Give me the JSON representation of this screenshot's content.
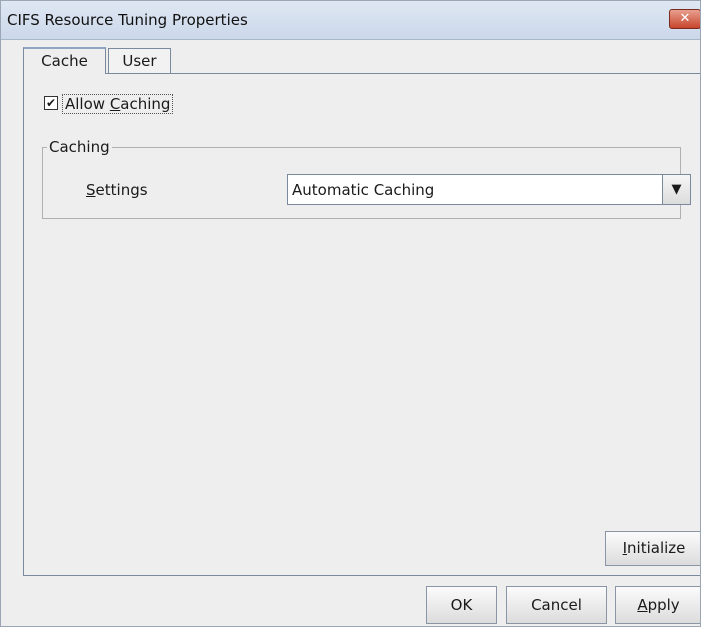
{
  "window": {
    "title": "CIFS Resource Tuning Properties",
    "close_glyph": "✕"
  },
  "tabs": [
    {
      "label": "Cache",
      "active": true
    },
    {
      "label": "User",
      "active": false
    }
  ],
  "cache": {
    "allow_caching": {
      "checked": true,
      "check_glyph": "✔",
      "label_prefix": "Allow ",
      "label_mnemonic": "C",
      "label_rest": "aching"
    },
    "group_title": "Caching",
    "settings": {
      "label_mnemonic": "S",
      "label_rest": "ettings",
      "value": "Automatic Caching",
      "arrow_glyph": "▼"
    },
    "initialize": {
      "mnemonic": "I",
      "rest": "nitialize"
    }
  },
  "buttons": {
    "ok": "OK",
    "cancel": "Cancel",
    "apply": {
      "mnemonic": "A",
      "rest": "pply"
    }
  }
}
